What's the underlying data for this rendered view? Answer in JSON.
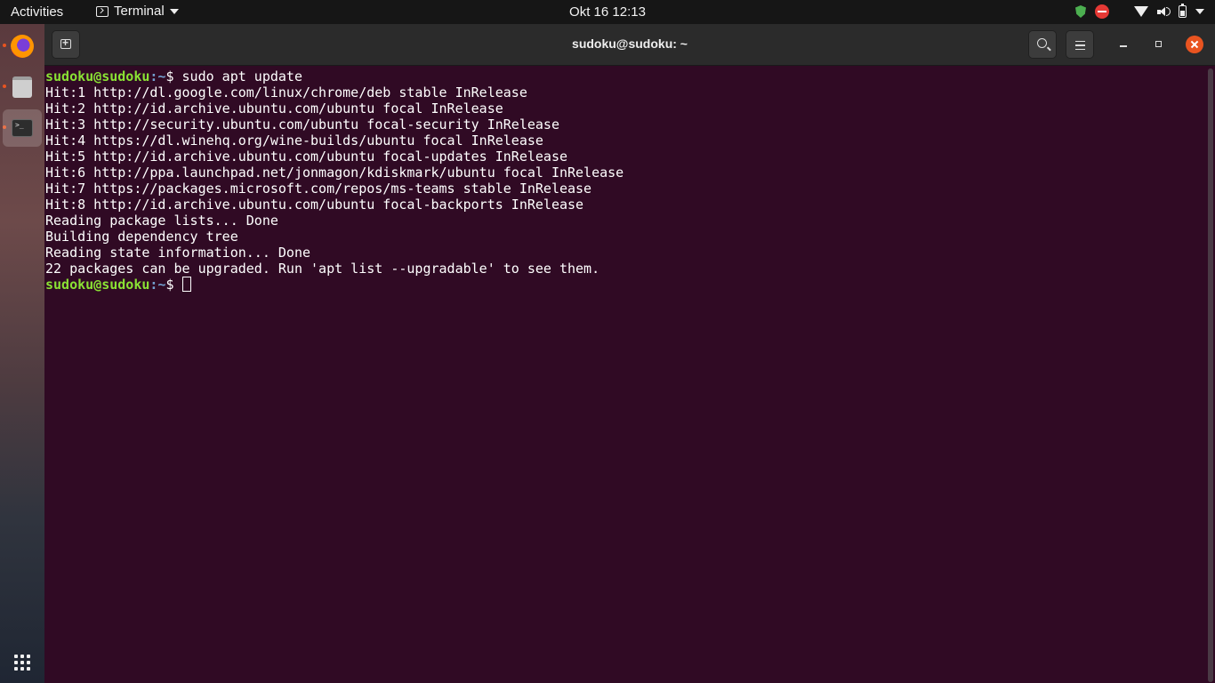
{
  "topbar": {
    "activities": "Activities",
    "app_name": "Terminal",
    "clock": "Okt 16  12:13",
    "tray_icons": [
      "shield-icon",
      "do-not-disturb-icon",
      "wifi-icon",
      "volume-icon",
      "battery-icon",
      "system-menu-caret-icon"
    ]
  },
  "dock": {
    "items": [
      "firefox",
      "files",
      "terminal"
    ],
    "show_apps": "apps-grid-icon"
  },
  "window": {
    "title": "sudoku@sudoku: ~"
  },
  "terminal": {
    "prompt1": {
      "user_host": "sudoku@sudoku",
      "path": ":~",
      "symbol": "$",
      "command": " sudo apt update"
    },
    "output": [
      "Hit:1 http://dl.google.com/linux/chrome/deb stable InRelease",
      "Hit:2 http://id.archive.ubuntu.com/ubuntu focal InRelease",
      "Hit:3 http://security.ubuntu.com/ubuntu focal-security InRelease",
      "Hit:4 https://dl.winehq.org/wine-builds/ubuntu focal InRelease",
      "Hit:5 http://id.archive.ubuntu.com/ubuntu focal-updates InRelease",
      "Hit:6 http://ppa.launchpad.net/jonmagon/kdiskmark/ubuntu focal InRelease",
      "Hit:7 https://packages.microsoft.com/repos/ms-teams stable InRelease",
      "Hit:8 http://id.archive.ubuntu.com/ubuntu focal-backports InRelease",
      "Reading package lists... Done",
      "Building dependency tree",
      "Reading state information... Done",
      "22 packages can be upgraded. Run 'apt list --upgradable' to see them."
    ],
    "prompt2": {
      "user_host": "sudoku@sudoku",
      "path": ":~",
      "symbol": "$ "
    }
  },
  "colors": {
    "terminal_bg": "#300a24",
    "prompt_user": "#8ae234",
    "prompt_path": "#729fcf",
    "close_button": "#e95420"
  }
}
